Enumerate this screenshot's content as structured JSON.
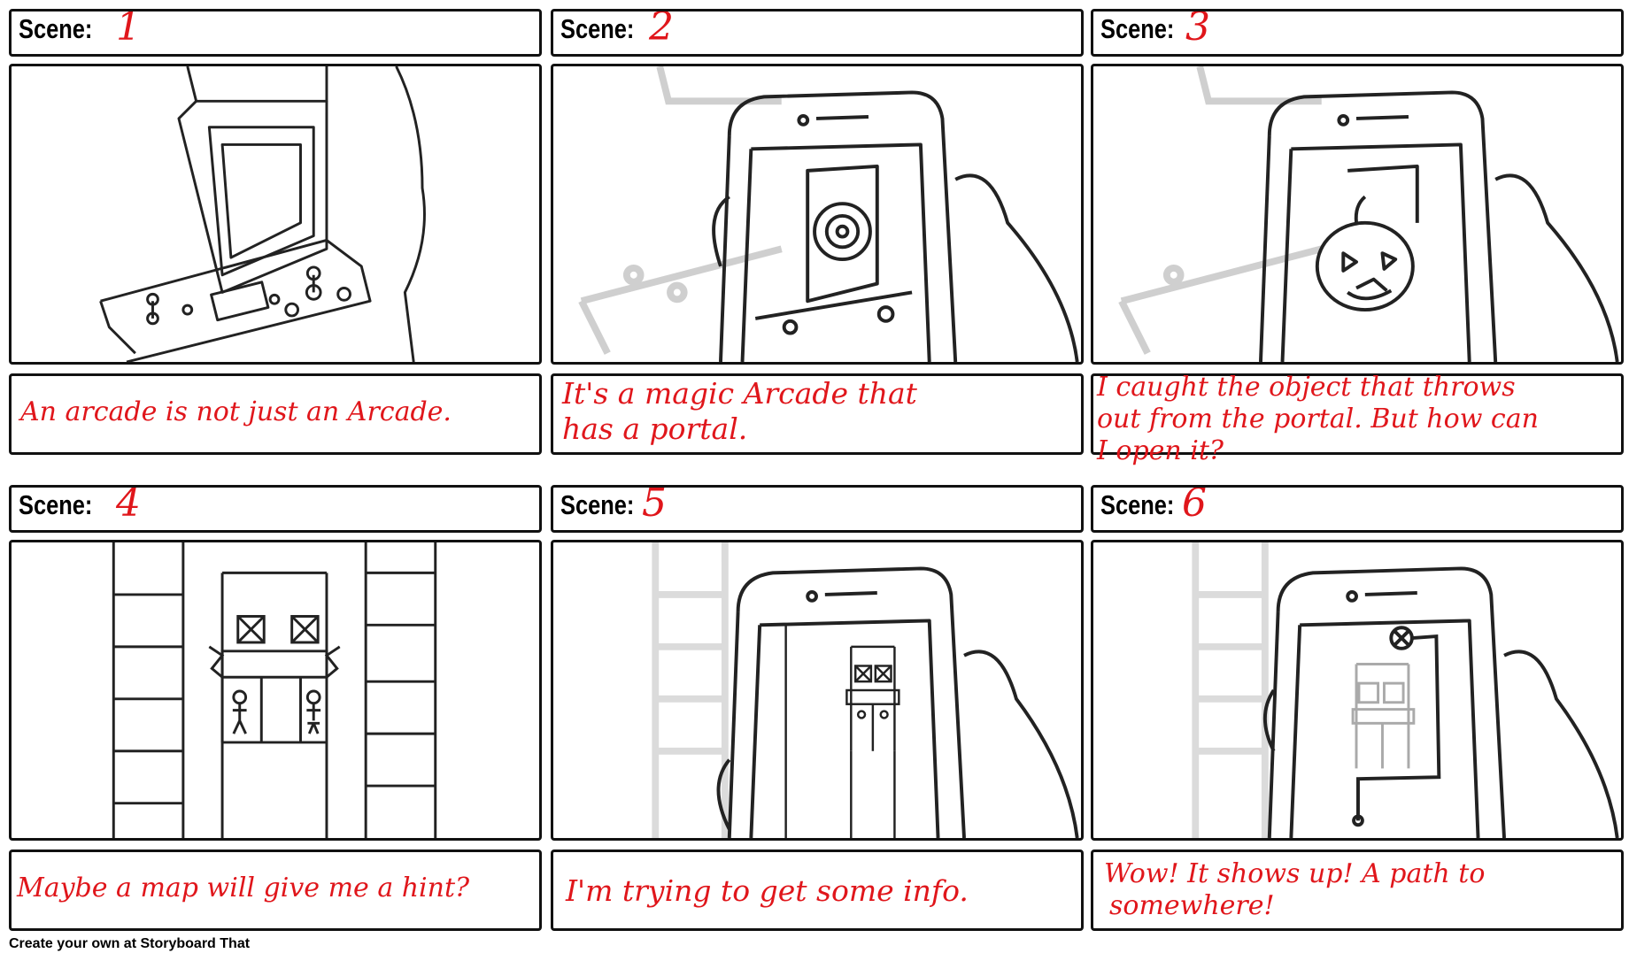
{
  "scene_prefix": "Scene:",
  "scenes": [
    {
      "number": "1",
      "caption_lines": [
        "An arcade is not just an Arcade."
      ]
    },
    {
      "number": "2",
      "caption_lines": [
        "It's a magic Arcade that",
        "has a portal."
      ]
    },
    {
      "number": "3",
      "caption_lines": [
        "I caught the object that throws",
        "out from the portal. But how can",
        "I open it?"
      ]
    },
    {
      "number": "4",
      "caption_lines": [
        "Maybe a map will give me a hint?"
      ]
    },
    {
      "number": "5",
      "caption_lines": [
        "I'm trying to get some info."
      ]
    },
    {
      "number": "6",
      "caption_lines": [
        "Wow! It shows up! A path to",
        "somewhere!"
      ]
    }
  ],
  "footer": "Create your own at Storyboard That",
  "colors": {
    "handwriting": "#e0161b",
    "border": "#111111"
  }
}
